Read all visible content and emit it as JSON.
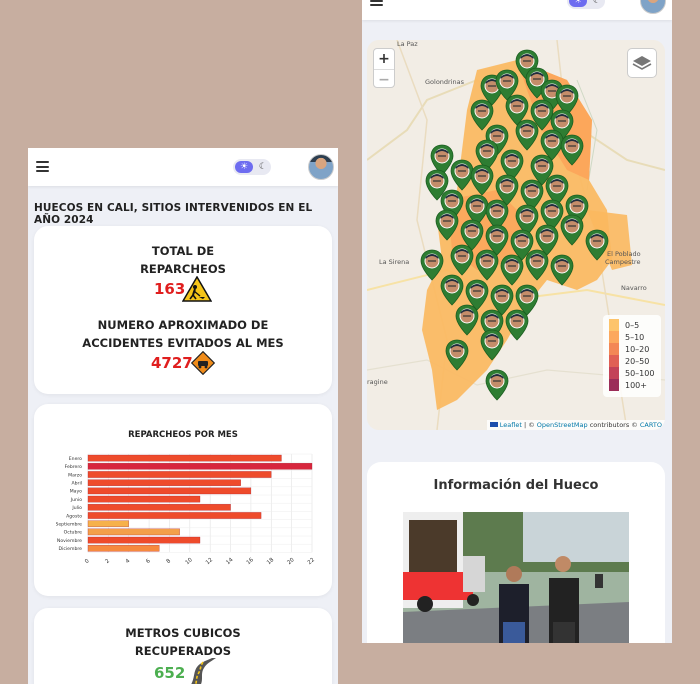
{
  "left": {
    "title": "HUECOS EN CALI, SITIOS INTERVENIDOS EN EL AÑO 2024",
    "total_label_1": "TOTAL DE",
    "total_label_2": "REPARCHEOS",
    "total_value": "163",
    "accidents_label_1": "NUMERO APROXIMADO DE",
    "accidents_label_2": "ACCIDENTES EVITADOS AL MES",
    "accidents_value": "4727",
    "metros_label_1": "METROS CUBICOS",
    "metros_label_2": "RECUPERADOS",
    "metros_value": "652"
  },
  "chart_data": {
    "type": "bar",
    "orientation": "horizontal",
    "title": "REPARCHEOS POR MES",
    "categories": [
      "Enero",
      "Febrero",
      "Marzo",
      "Abril",
      "Mayo",
      "Junio",
      "Julio",
      "Agosto",
      "Septiembre",
      "Octubre",
      "Noviembre",
      "Diciembre"
    ],
    "values": [
      19,
      22,
      18,
      15,
      16,
      11,
      14,
      17,
      4,
      9,
      11,
      7
    ],
    "xlim": [
      0,
      22
    ],
    "xticks": [
      0,
      2,
      4,
      6,
      8,
      10,
      12,
      14,
      16,
      18,
      20,
      22
    ],
    "grid": true,
    "colors": [
      "#ee4b2b",
      "#d7263d",
      "#ee4b2b",
      "#ee4b2b",
      "#ee4b2b",
      "#ee4b2b",
      "#ee4b2b",
      "#ee4b2b",
      "#f6b14a",
      "#f3a04a",
      "#ee4b2b",
      "#f6893e"
    ]
  },
  "map": {
    "zoom_in": "+",
    "zoom_out": "−",
    "places": [
      "La Paz",
      "Golondrinas",
      "La Sirena",
      "El Poblado",
      "Campestre",
      "Navarro",
      "ragine"
    ],
    "legend": [
      {
        "label": "0–5",
        "color": "#fdc46b"
      },
      {
        "label": "5–10",
        "color": "#fca85e"
      },
      {
        "label": "10–20",
        "color": "#f38756"
      },
      {
        "label": "20–50",
        "color": "#e06055"
      },
      {
        "label": "50–100",
        "color": "#c34258"
      },
      {
        "label": "100+",
        "color": "#9b2d58"
      }
    ],
    "attribution_leaflet": "Leaflet",
    "attribution_sep": " | © ",
    "attribution_osm": "OpenStreetMap",
    "attribution_mid": " contributors © ",
    "attribution_carto": "CARTO"
  },
  "info": {
    "title": "Información del Hueco"
  },
  "theme": {
    "sun": "☀",
    "moon": "☾"
  }
}
